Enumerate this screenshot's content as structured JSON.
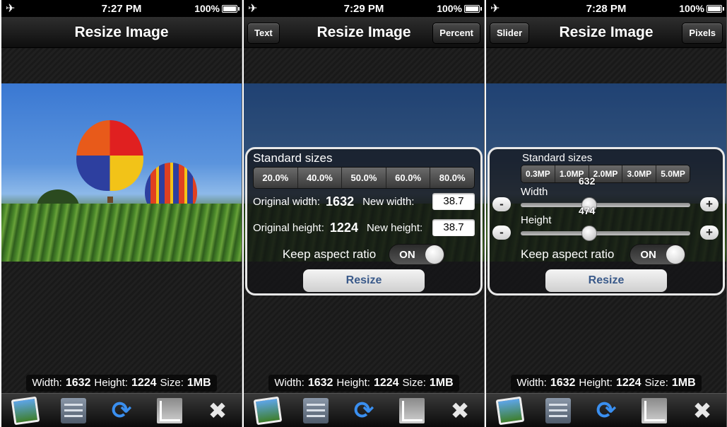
{
  "screens": [
    {
      "status": {
        "time": "7:27 PM",
        "battery": "100%"
      },
      "title": "Resize Image",
      "info": {
        "width_label": "Width:",
        "width": "1632",
        "height_label": "Height:",
        "height": "1224",
        "size_label": "Size:",
        "size": "1MB"
      }
    },
    {
      "status": {
        "time": "7:29 PM",
        "battery": "100%"
      },
      "title": "Resize Image",
      "left_button": "Text",
      "right_button": "Percent",
      "panel": {
        "heading": "Standard sizes",
        "options": [
          "20.0%",
          "40.0%",
          "50.0%",
          "60.0%",
          "80.0%"
        ],
        "original_width_label": "Original width:",
        "original_width": "1632",
        "new_width_label": "New width:",
        "new_width": "38.7",
        "original_height_label": "Original height:",
        "original_height": "1224",
        "new_height_label": "New height:",
        "new_height": "38.7",
        "aspect_label": "Keep aspect ratio",
        "toggle": "ON",
        "resize": "Resize"
      },
      "info": {
        "width_label": "Width:",
        "width": "1632",
        "height_label": "Height:",
        "height": "1224",
        "size_label": "Size:",
        "size": "1MB"
      }
    },
    {
      "status": {
        "time": "7:28 PM",
        "battery": "100%"
      },
      "title": "Resize Image",
      "left_button": "Slider",
      "right_button": "Pixels",
      "panel": {
        "heading": "Standard sizes",
        "options": [
          "0.3MP",
          "1.0MP",
          "2.0MP",
          "3.0MP",
          "5.0MP"
        ],
        "width_label": "Width",
        "width_value": "632",
        "height_label": "Height",
        "height_value": "474",
        "minus": "-",
        "plus": "+",
        "aspect_label": "Keep aspect ratio",
        "toggle": "ON",
        "resize": "Resize"
      },
      "info": {
        "width_label": "Width:",
        "width": "1632",
        "height_label": "Height:",
        "height": "1224",
        "size_label": "Size:",
        "size": "1MB"
      }
    }
  ],
  "icons": {
    "airplane": "airplane-icon",
    "battery": "battery-icon",
    "toolbar": [
      "photo-library-icon",
      "settings-list-icon",
      "rotate-icon",
      "crop-icon",
      "tools-icon"
    ]
  },
  "colors": {
    "accent_blue": "#3a8ff0",
    "resize_text": "#3a5a8a"
  }
}
